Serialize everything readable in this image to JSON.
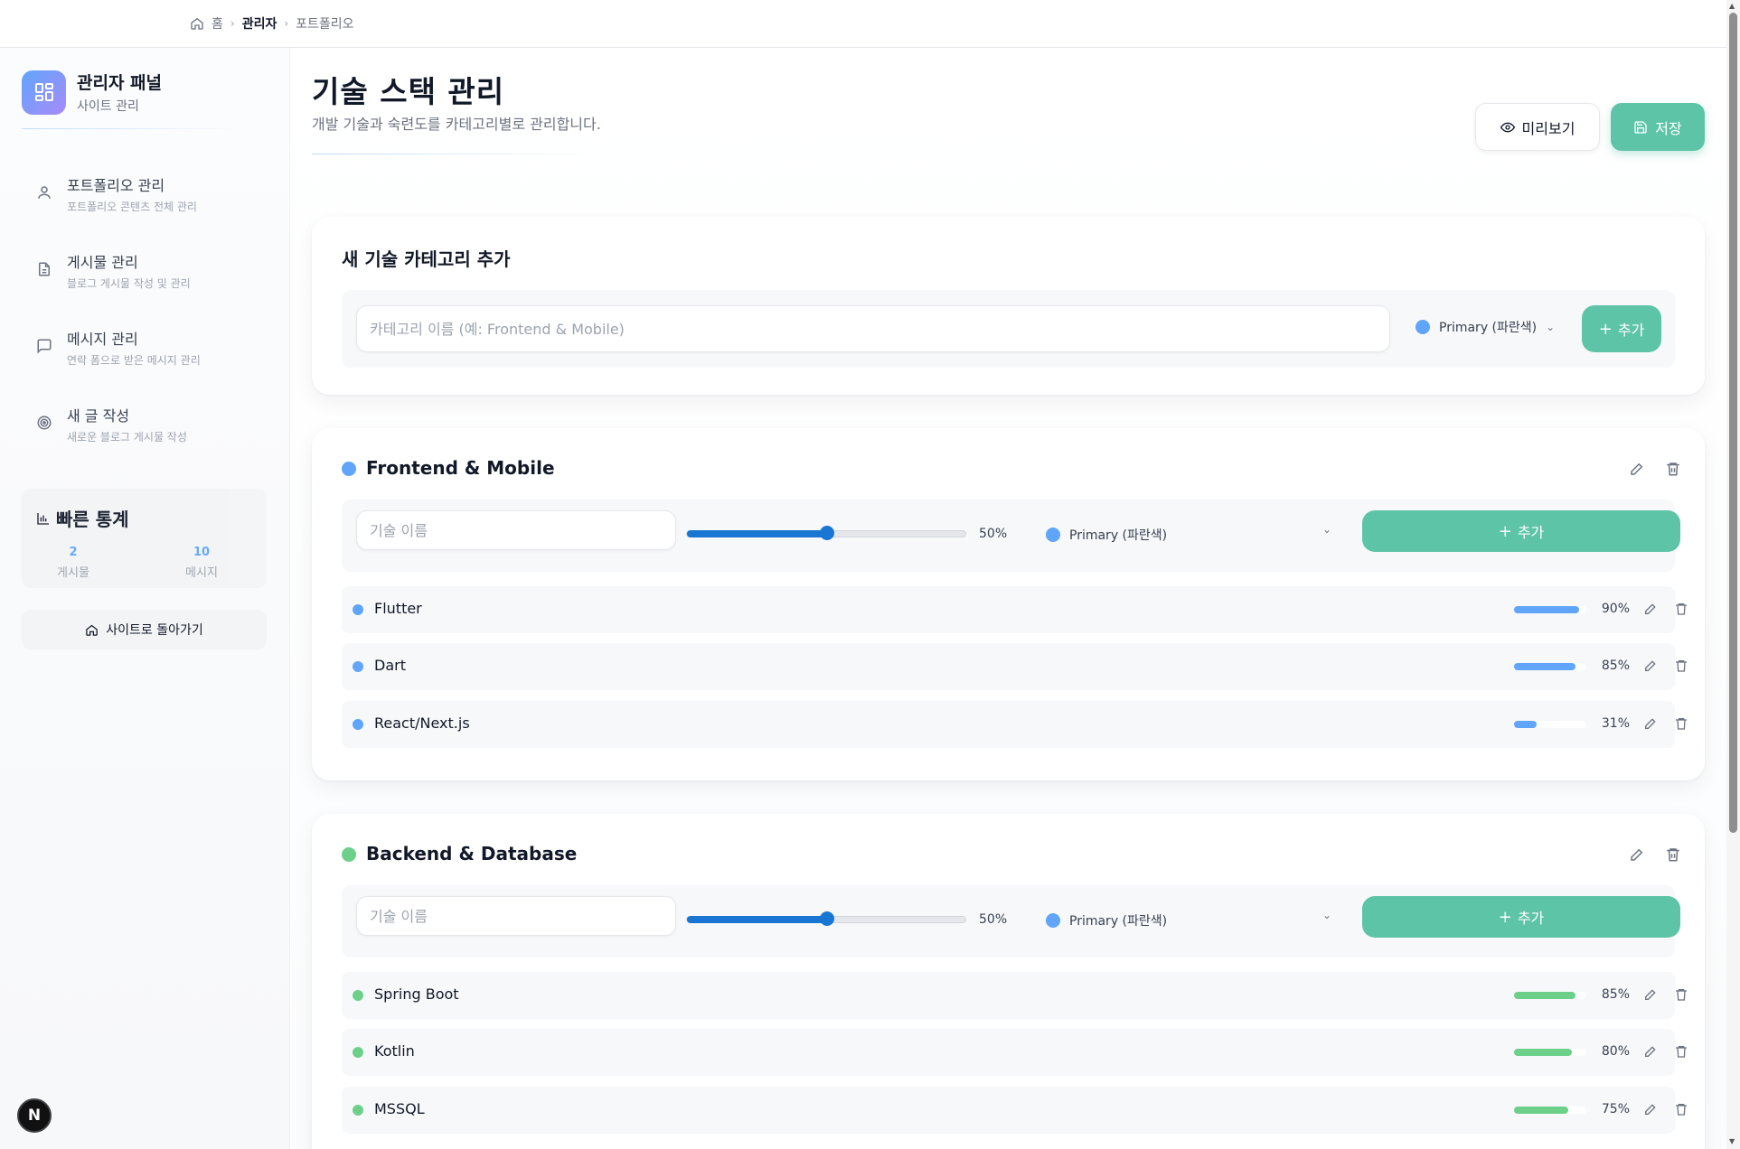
{
  "breadcrumb": {
    "home": "홈",
    "admin": "관리자",
    "current": "포트폴리오"
  },
  "sidebar": {
    "brand_title": "관리자 패널",
    "brand_sub": "사이트 관리",
    "items": [
      {
        "label": "포트폴리오 관리",
        "desc": "포트폴리오 콘텐츠 전체 관리",
        "icon": "user-icon"
      },
      {
        "label": "게시물 관리",
        "desc": "블로그 게시물 작성 및 관리",
        "icon": "document-icon"
      },
      {
        "label": "메시지 관리",
        "desc": "연락 폼으로 받은 메시지 관리",
        "icon": "message-icon"
      },
      {
        "label": "새 글 작성",
        "desc": "새로운 블로그 게시물 작성",
        "icon": "target-icon"
      }
    ],
    "stats_title": "빠른 통계",
    "stats": [
      {
        "value": "2",
        "label": "게시물"
      },
      {
        "value": "10",
        "label": "메시지"
      }
    ],
    "back_label": "사이트로 돌아가기",
    "badge": "N"
  },
  "header": {
    "title": "기술 스택 관리",
    "subtitle": "개발 기술과 숙련도를 카테고리별로 관리합니다.",
    "preview_label": "미리보기",
    "save_label": "저장"
  },
  "new_category": {
    "title": "새 기술 카테고리 추가",
    "placeholder": "카테고리 이름 (예: Frontend & Mobile)",
    "color_label": "Primary (파란색)",
    "add_label": "추가"
  },
  "categories": [
    {
      "name": "Frontend & Mobile",
      "color": "#60a5fa",
      "input_placeholder": "기술 이름",
      "slider_value": 50,
      "slider_label": "50%",
      "color_label": "Primary (파란색)",
      "add_label": "추가",
      "skills": [
        {
          "name": "Flutter",
          "level": 90,
          "label": "90%"
        },
        {
          "name": "Dart",
          "level": 85,
          "label": "85%"
        },
        {
          "name": "React/Next.js",
          "level": 31,
          "label": "31%"
        }
      ]
    },
    {
      "name": "Backend & Database",
      "color": "#6dd08a",
      "input_placeholder": "기술 이름",
      "slider_value": 50,
      "slider_label": "50%",
      "color_label": "Primary (파란색)",
      "add_label": "추가",
      "skills": [
        {
          "name": "Spring Boot",
          "level": 85,
          "label": "85%"
        },
        {
          "name": "Kotlin",
          "level": 80,
          "label": "80%"
        },
        {
          "name": "MSSQL",
          "level": 75,
          "label": "75%"
        }
      ]
    }
  ],
  "colors": {
    "accent": "#5ec4a7",
    "primary_dot": "#60a5fa",
    "slider": "#1976d2"
  }
}
